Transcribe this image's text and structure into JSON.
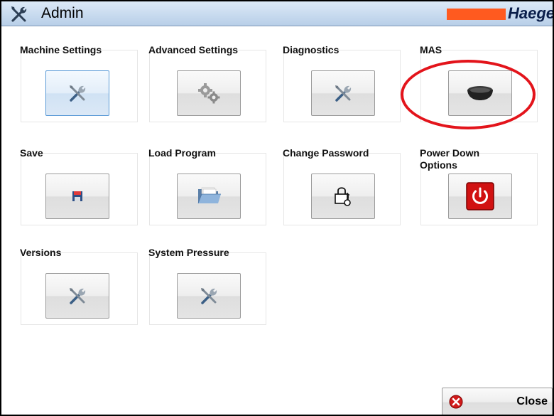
{
  "header": {
    "title": "Admin",
    "brand": "Haeger",
    "title_icon": "tools-icon"
  },
  "tiles": [
    {
      "label": "Machine Settings",
      "icon": "tools-icon"
    },
    {
      "label": "Advanced Settings",
      "icon": "gears-icon"
    },
    {
      "label": "Diagnostics",
      "icon": "tools-icon"
    },
    {
      "label": "MAS",
      "icon": "mas-puck-icon"
    },
    {
      "label": "Save",
      "icon": "floppy-disk-icon"
    },
    {
      "label": "Load Program",
      "icon": "folder-open-icon"
    },
    {
      "label": "Change Password",
      "icon": "lock-key-icon"
    },
    {
      "label": "Power Down\nOptions",
      "icon": "power-icon"
    },
    {
      "label": "Versions",
      "icon": "tools-icon"
    },
    {
      "label": "System Pressure",
      "icon": "tools-icon"
    }
  ],
  "footer": {
    "close_label": "Close",
    "close_icon": "close-icon"
  },
  "colors": {
    "brand_accent": "#ff5a1f",
    "brand_text": "#0a1e4a",
    "highlight_circle": "#e3141b",
    "power_red": "#d11212"
  }
}
